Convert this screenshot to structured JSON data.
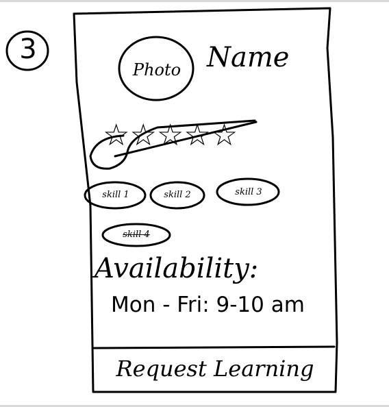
{
  "step_number": "3",
  "profile": {
    "photo_label": "Photo",
    "name_label": "Name",
    "rating_stars": "☆☆☆☆☆",
    "rating_display": "stars crossed out (sketch)"
  },
  "skills": [
    {
      "label": "skill 1"
    },
    {
      "label": "skill 2"
    },
    {
      "label": "skill 3"
    },
    {
      "label": "skill 4"
    }
  ],
  "availability": {
    "label": "Availability:",
    "value": "Mon - Fri: 9-10 am"
  },
  "actions": {
    "request_label": "Request Learning"
  }
}
